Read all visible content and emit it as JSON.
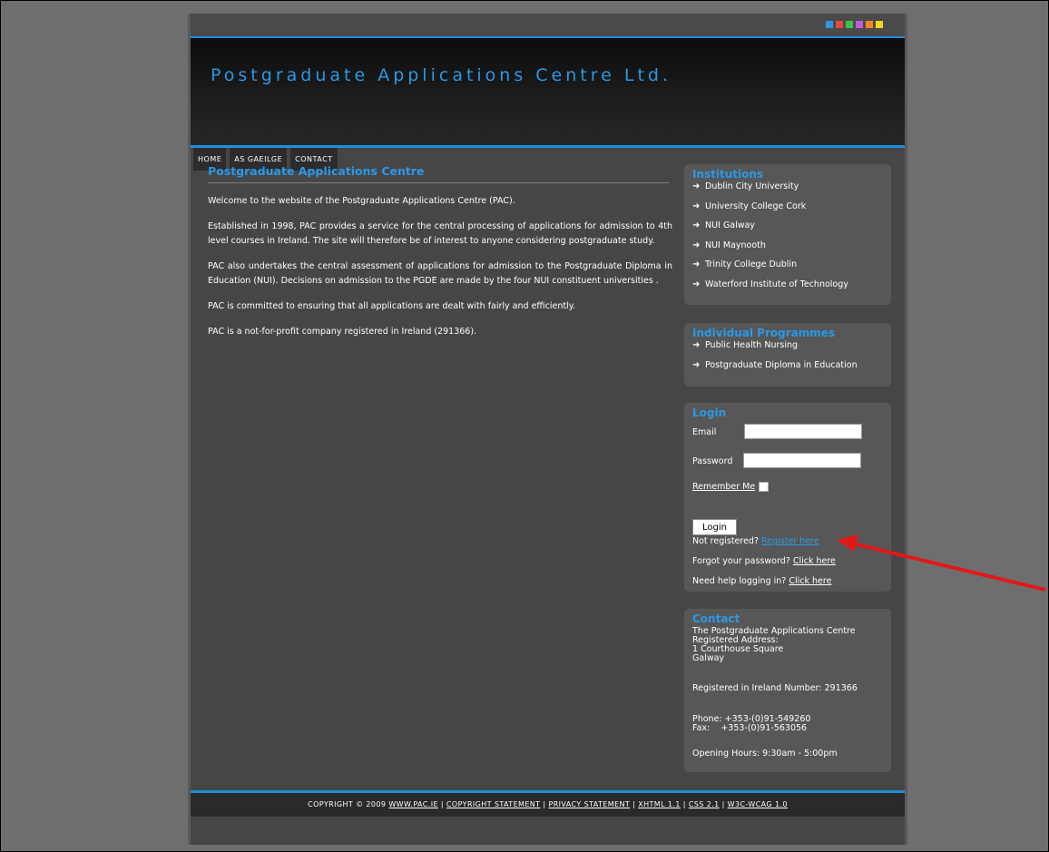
{
  "site_title": "Postgraduate Applications Centre Ltd.",
  "swatch_colors": [
    "#2b98e6",
    "#e8463c",
    "#3cc44a",
    "#c35bd9",
    "#ee8c1a",
    "#f2d81e"
  ],
  "nav": [
    {
      "label": "HOME"
    },
    {
      "label": "AS GAEILGE"
    },
    {
      "label": "CONTACT"
    }
  ],
  "main": {
    "heading": "Postgraduate Applications Centre",
    "paragraphs": [
      "Welcome to the website of the Postgraduate Applications Centre (PAC).",
      "Established in 1998, PAC provides a service for the central processing of applications for admission to 4th level courses in Ireland. The site will therefore be of interest to anyone considering postgraduate study.",
      "PAC also undertakes the central assessment of applications for admission to the Postgraduate Diploma in Education (NUI). Decisions on admission to the PGDE are made by the four NUI constituent universities .",
      "PAC is committed to ensuring that all applications are dealt with fairly and efficiently.",
      "PAC is a not-for-profit company registered in Ireland (291366)."
    ]
  },
  "institutions": {
    "title": "Institutions",
    "items": [
      "Dublin City University",
      "University College Cork",
      "NUI Galway",
      "NUI Maynooth",
      "Trinity College Dublin",
      "Waterford Institute of Technology"
    ]
  },
  "programmes": {
    "title": "Individual Programmes",
    "items": [
      "Public Health Nursing",
      "Postgraduate Diploma in Education"
    ]
  },
  "login": {
    "title": "Login",
    "email_label": "Email",
    "email_value": "",
    "password_label": "Password",
    "password_value": "",
    "remember_label": "Remember Me",
    "button_label": "Login",
    "not_registered": "Not registered?",
    "register_link": "Register here",
    "forgot_text": "Forgot your password?",
    "forgot_link": "Click here",
    "help_text": "Need help logging in?",
    "help_link": "Click here"
  },
  "contact": {
    "title": "Contact",
    "line1": "The Postgraduate Applications Centre",
    "line2": "Registered Address:",
    "line3": "1 Courthouse Square",
    "line4": "Galway",
    "registered": "Registered in Ireland Number: 291366",
    "phone": "Phone: +353-(0)91-549260",
    "fax": "Fax:    +353-(0)91-563056",
    "hours": "Opening Hours: 9:30am - 5:00pm"
  },
  "footer": {
    "copyright": "COPYRIGHT © 2009",
    "site_link": "WWW.PAC.IE",
    "sep": "|",
    "copyright_statement": "COPYRIGHT STATEMENT",
    "privacy_statement": "PRIVACY STATEMENT",
    "xhtml": "XHTML 1.1",
    "css": "CSS 2.1",
    "wcag": "W3C-WCAG 1.0"
  },
  "annotation_color": "#e21818"
}
